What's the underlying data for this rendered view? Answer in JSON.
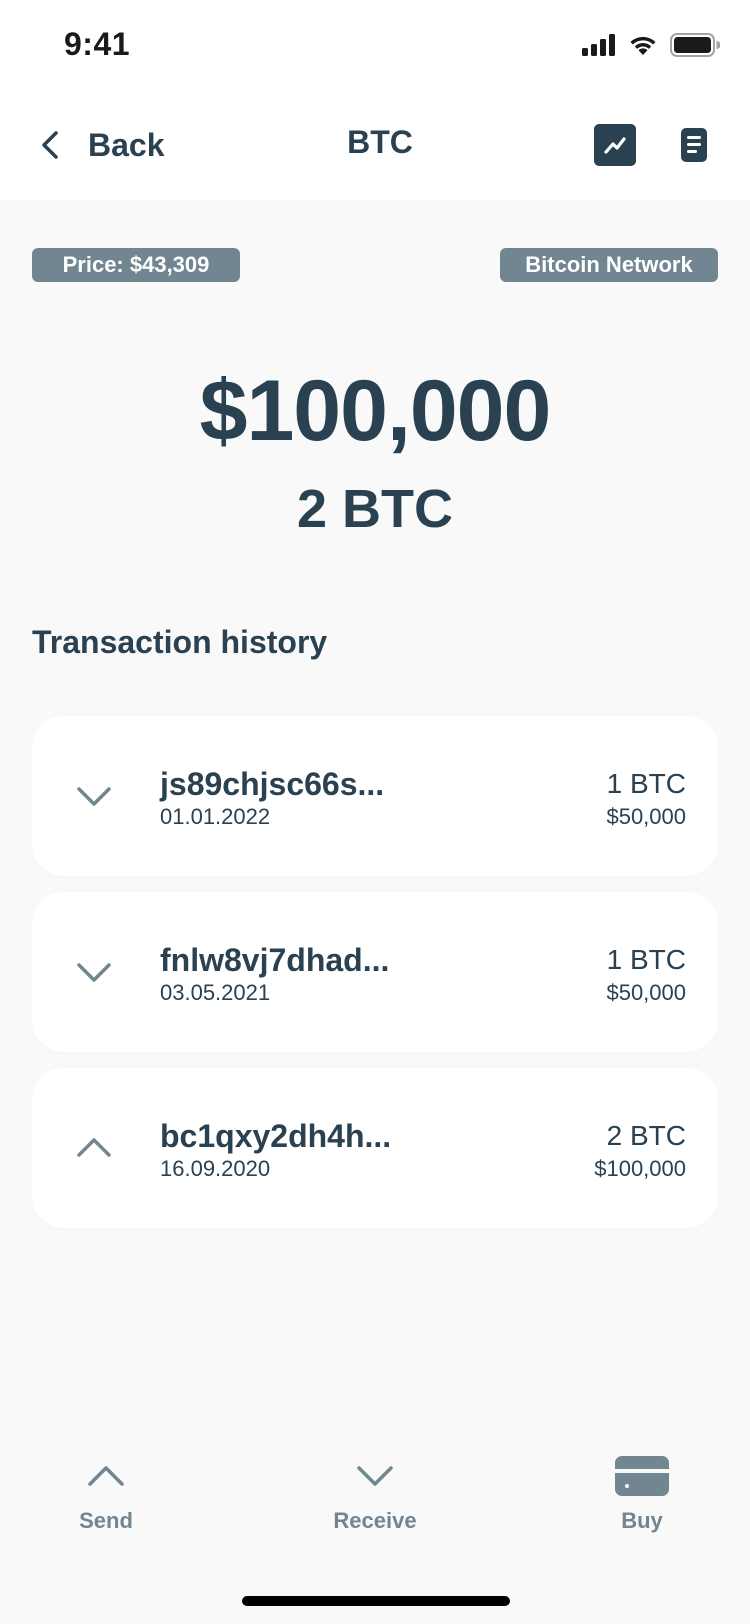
{
  "status_bar": {
    "time": "9:41"
  },
  "header": {
    "back_label": "Back",
    "title": "BTC"
  },
  "tags": {
    "price": "Price: $43,309",
    "network": "Bitcoin Network"
  },
  "balance": {
    "usd": "$100,000",
    "btc": "2 BTC"
  },
  "history": {
    "title": "Transaction history",
    "items": [
      {
        "id": "js89chjsc66s...",
        "date": "01.01.2022",
        "amount": "1 BTC",
        "usd": "$50,000",
        "direction": "incoming",
        "icon": "chevron-down-icon"
      },
      {
        "id": "fnlw8vj7dhad...",
        "date": "03.05.2021",
        "amount": "1 BTC",
        "usd": "$50,000",
        "direction": "incoming",
        "icon": "chevron-down-icon"
      },
      {
        "id": "bc1qxy2dh4h...",
        "date": "16.09.2020",
        "amount": "2 BTC",
        "usd": "$100,000",
        "direction": "outgoing",
        "icon": "chevron-up-icon"
      }
    ]
  },
  "bottom_nav": {
    "send": "Send",
    "receive": "Receive",
    "buy": "Buy"
  },
  "colors": {
    "primary": "#2a4152",
    "muted": "#718691",
    "background": "#f9f9f9",
    "card": "#ffffff"
  }
}
